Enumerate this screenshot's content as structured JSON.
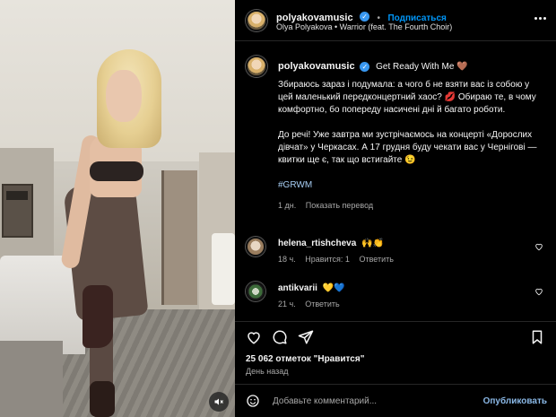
{
  "post": {
    "username": "polyakovamusic",
    "follow_label": "Подписаться",
    "audio_line": "Olya Polyakova • Warrior (feat. The Fourth Choir)"
  },
  "caption": {
    "username": "polyakovamusic",
    "title": "Get Ready With Me",
    "title_emoji": "🤎",
    "para1": "Збираюсь зараз і подумала: а чого б не взяти вас із собою у цей маленький передконцертний хаос? 💋 Обираю те, в чому комфортно, бо попереду насичені дні й багато роботи.",
    "para2": "До речі! Уже завтра ми зустрічаємось на концерті «Дорослих дівчат» у Черкасах. А 17 грудня буду чекати вас у Чернігові — квитки ще є, так що встигайте 😉",
    "hashtag": "#GRWM",
    "age": "1 дн.",
    "translate_label": "Показать перевод"
  },
  "comments": [
    {
      "username": "helena_rtishcheva",
      "text": "🙌👏",
      "age": "18 ч.",
      "likes_label": "Нравится: 1",
      "reply_label": "Ответить"
    },
    {
      "username": "antikvarii",
      "text": "💛💙",
      "age": "21 ч.",
      "reply_label": "Ответить"
    }
  ],
  "stats": {
    "likes_text": "25 062 отметок \"Нравится\"",
    "posted": "День назад"
  },
  "composer": {
    "placeholder": "Добавьте комментарий...",
    "post_label": "Опубликовать"
  },
  "icons": {
    "verified": "verified-badge-icon",
    "more": "more-options-icon",
    "heart": "heart-icon",
    "comment": "comment-icon",
    "share": "share-icon",
    "bookmark": "bookmark-icon",
    "emoji": "emoji-icon",
    "mute": "mute-icon"
  },
  "colors": {
    "accent": "#0095f6",
    "verified": "#3897f0",
    "background": "#000000"
  }
}
